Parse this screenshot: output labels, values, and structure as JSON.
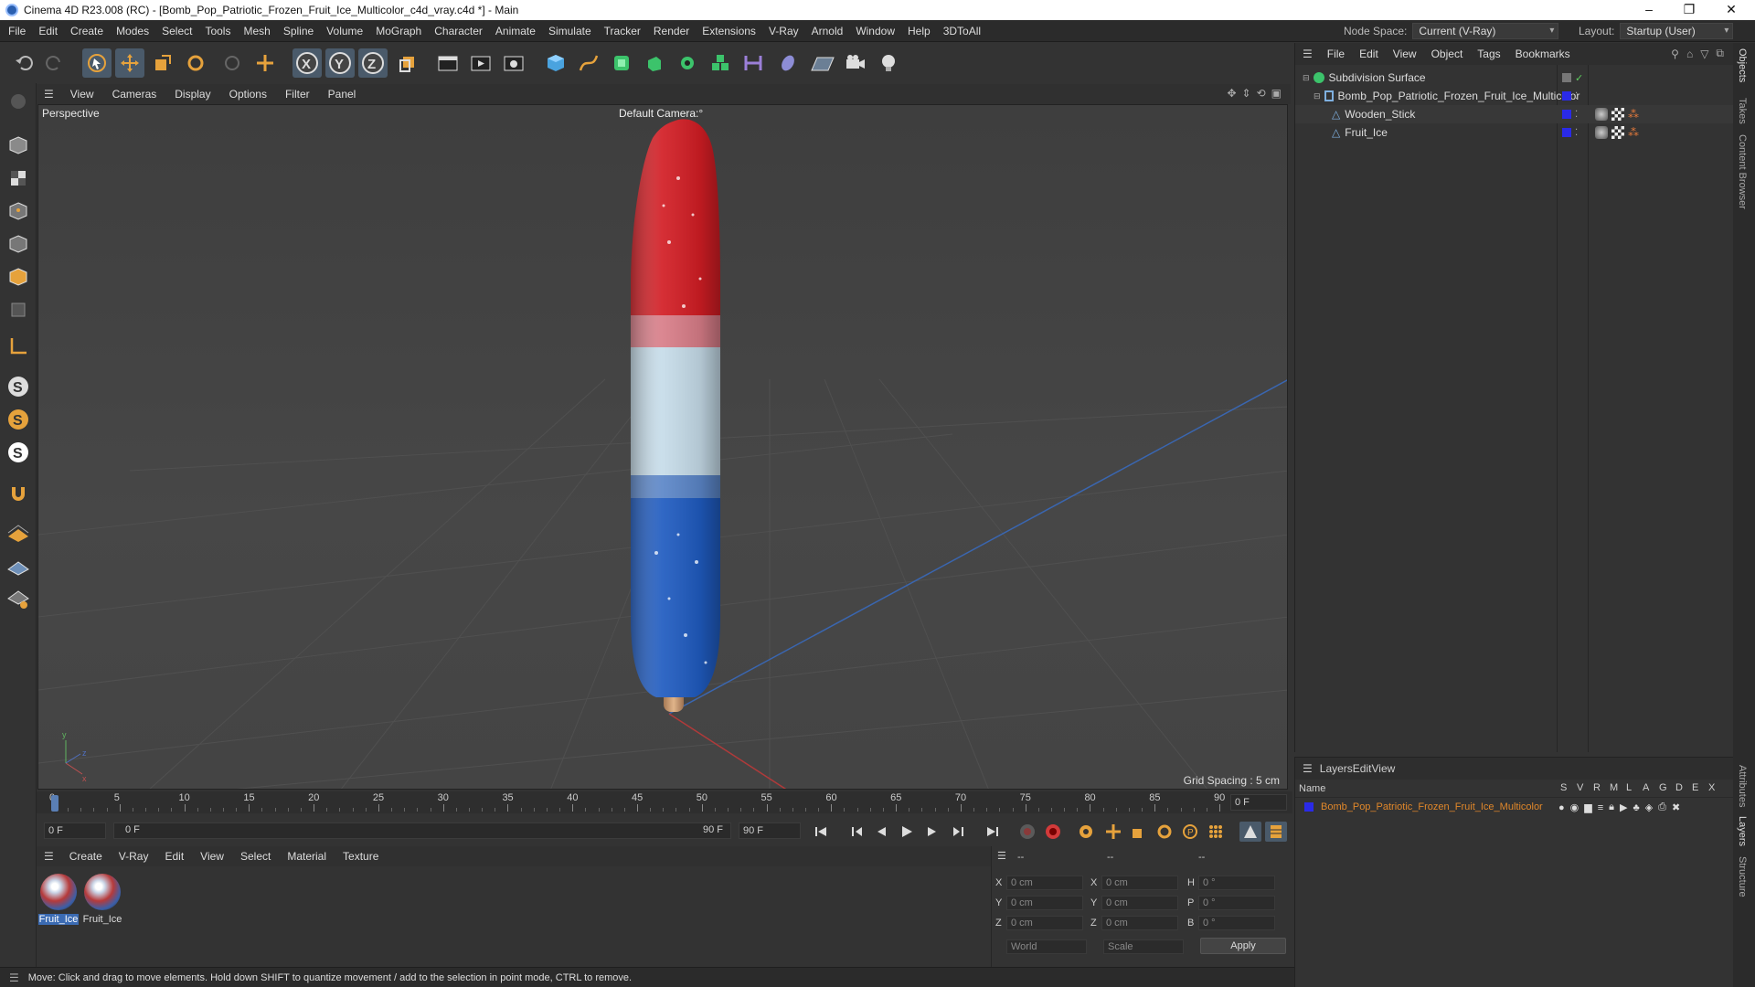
{
  "window": {
    "title": "Cinema 4D R23.008 (RC) - [Bomb_Pop_Patriotic_Frozen_Fruit_Ice_Multicolor_c4d_vray.c4d *] - Main"
  },
  "menu": [
    "File",
    "Edit",
    "Create",
    "Modes",
    "Select",
    "Tools",
    "Mesh",
    "Spline",
    "Volume",
    "MoGraph",
    "Character",
    "Animate",
    "Simulate",
    "Tracker",
    "Render",
    "Extensions",
    "V-Ray",
    "Arnold",
    "Window",
    "Help",
    "3DToAll"
  ],
  "nodespace": {
    "label": "Node Space:",
    "value": "Current (V-Ray)"
  },
  "layout": {
    "label": "Layout:",
    "value": "Startup (User)"
  },
  "viewport": {
    "menu": [
      "View",
      "Cameras",
      "Display",
      "Options",
      "Filter",
      "Panel"
    ],
    "label": "Perspective",
    "camera": "Default Camera:°",
    "grid": "Grid Spacing : 5 cm"
  },
  "timeline": {
    "ticks": [
      "0",
      "5",
      "10",
      "15",
      "20",
      "25",
      "30",
      "35",
      "40",
      "45",
      "50",
      "55",
      "60",
      "65",
      "70",
      "75",
      "80",
      "85",
      "90"
    ],
    "end_field": "0 F"
  },
  "transport": {
    "start": "0 F",
    "current": "0 F",
    "range_end": "90 F",
    "end": "90 F"
  },
  "materials": {
    "menu": [
      "Create",
      "V-Ray",
      "Edit",
      "View",
      "Select",
      "Material",
      "Texture"
    ],
    "items": [
      "Fruit_Ice",
      "Fruit_Ice"
    ]
  },
  "coords": {
    "headers": [
      "--",
      "--",
      "--"
    ],
    "rows": [
      {
        "a": "X",
        "av": "0 cm",
        "b": "X",
        "bv": "0 cm",
        "c": "H",
        "cv": "0 °"
      },
      {
        "a": "Y",
        "av": "0 cm",
        "b": "Y",
        "bv": "0 cm",
        "c": "P",
        "cv": "0 °"
      },
      {
        "a": "Z",
        "av": "0 cm",
        "b": "Z",
        "bv": "0 cm",
        "c": "B",
        "cv": "0 °"
      }
    ],
    "world": "World",
    "scale": "Scale",
    "apply": "Apply"
  },
  "status": "Move: Click and drag to move elements. Hold down SHIFT to quantize movement / add to the selection in point mode, CTRL to remove.",
  "objects": {
    "menu": [
      "File",
      "Edit",
      "View",
      "Object",
      "Tags",
      "Bookmarks"
    ],
    "items": [
      "Subdivision Surface",
      "Bomb_Pop_Patriotic_Frozen_Fruit_Ice_Multicolor",
      "Wooden_Stick",
      "Fruit_Ice"
    ]
  },
  "layers": {
    "menu": [
      "Layers",
      "Edit",
      "View"
    ],
    "header_name": "Name",
    "cols": [
      "S",
      "V",
      "R",
      "M",
      "L",
      "A",
      "G",
      "D",
      "E",
      "X"
    ],
    "item": "Bomb_Pop_Patriotic_Frozen_Fruit_Ice_Multicolor"
  },
  "side_tabs": [
    "Objects",
    "Takes",
    "Content Browser",
    "Attributes",
    "Layers",
    "Structure"
  ]
}
